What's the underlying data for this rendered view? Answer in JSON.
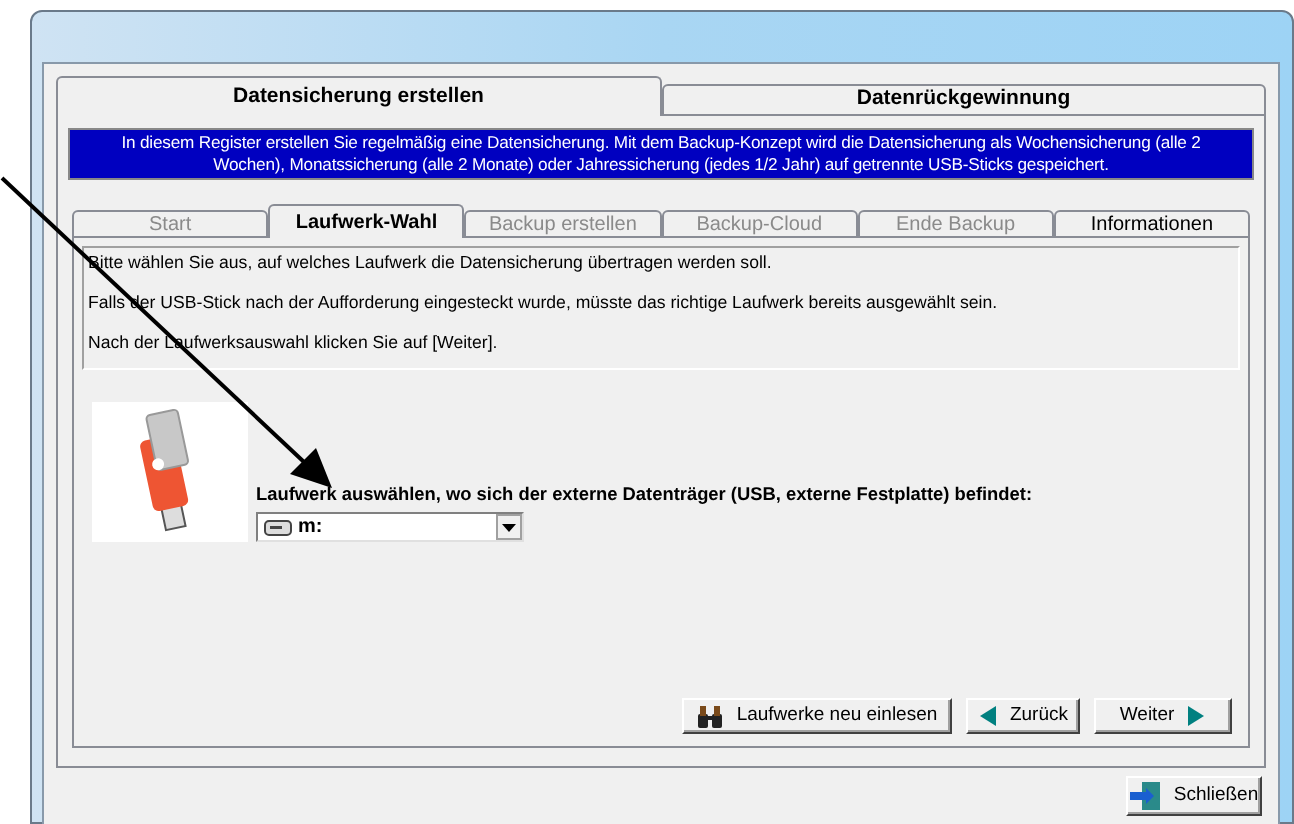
{
  "outer_tabs": [
    {
      "label": "Datensicherung erstellen",
      "selected": true
    },
    {
      "label": "Datenrückgewinnung",
      "selected": false
    }
  ],
  "info_banner": "In diesem Register erstellen Sie regelmäßig eine Datensicherung. Mit dem Backup-Konzept wird die Datensicherung als Wochensicherung (alle 2 Wochen), Monatssicherung (alle 2 Monate) oder Jahressicherung (jedes 1/2 Jahr) auf getrennte USB-Sticks gespeichert.",
  "inner_tabs": [
    {
      "label": "Start",
      "selected": false,
      "disabled": true
    },
    {
      "label": "Laufwerk-Wahl",
      "selected": true,
      "disabled": false
    },
    {
      "label": "Backup erstellen",
      "selected": false,
      "disabled": true
    },
    {
      "label": "Backup-Cloud",
      "selected": false,
      "disabled": true
    },
    {
      "label": "Ende Backup",
      "selected": false,
      "disabled": true
    },
    {
      "label": "Informationen",
      "selected": false,
      "disabled": false
    }
  ],
  "instructions": [
    "Bitte wählen Sie aus, auf welches Laufwerk die Datensicherung übertragen werden soll.",
    "Falls der USB-Stick nach der Aufforderung eingesteckt wurde, müsste das richtige Laufwerk bereits ausgewählt sein.",
    "Nach der Laufwerksauswahl klicken Sie auf [Weiter]."
  ],
  "drive_label": "Laufwerk auswählen, wo sich der externe Datenträger (USB, externe Festplatte) befindet:",
  "drive_select": {
    "value": "m:"
  },
  "buttons": [
    {
      "label": "Laufwerke neu einlesen",
      "kind": "binoculars"
    },
    {
      "label": "Zurück",
      "kind": "back"
    },
    {
      "label": "Weiter",
      "kind": "next"
    }
  ],
  "close_button": {
    "label": "Schließen"
  }
}
